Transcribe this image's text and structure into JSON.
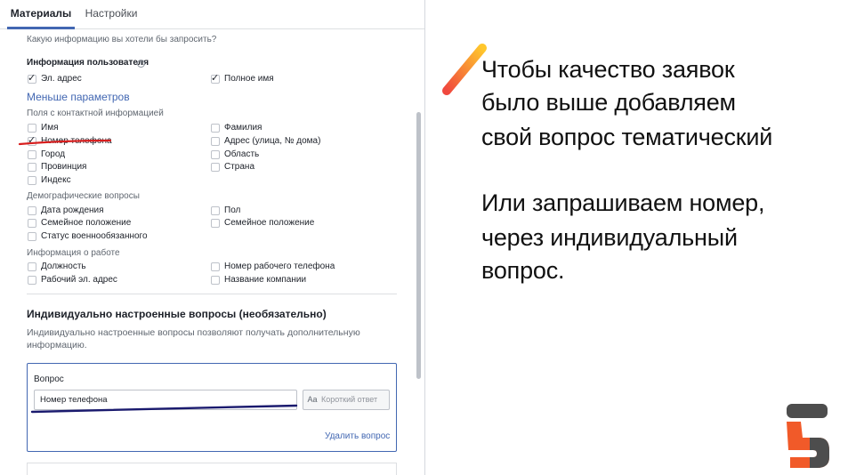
{
  "tabs": [
    {
      "label": "Материалы",
      "active": true
    },
    {
      "label": "Настройки",
      "active": false
    }
  ],
  "form": {
    "question_prompt": "Какую информацию вы хотели бы запросить?",
    "user_info_title": "Информация пользователя",
    "info_glyph": "i",
    "top_options": [
      {
        "label": "Эл. адрес",
        "checked": true
      },
      {
        "label": "Полное имя",
        "checked": true
      }
    ],
    "fewer_params": "Меньше параметров",
    "contact_title": "Поля с контактной информацией",
    "contact_fields": [
      {
        "label": "Имя",
        "checked": false
      },
      {
        "label": "Фамилия",
        "checked": false
      },
      {
        "label": "Номер телефона",
        "checked": true
      },
      {
        "label": "Адрес (улица, № дома)",
        "checked": false
      },
      {
        "label": "Город",
        "checked": false
      },
      {
        "label": "Область",
        "checked": false
      },
      {
        "label": "Провинция",
        "checked": false
      },
      {
        "label": "Страна",
        "checked": false
      },
      {
        "label": "Индекс",
        "checked": false
      }
    ],
    "demo_title": "Демографические вопросы",
    "demo_fields": [
      {
        "label": "Дата рождения",
        "checked": false
      },
      {
        "label": "Пол",
        "checked": false
      },
      {
        "label": "Семейное положение",
        "checked": false
      },
      {
        "label": "Семейное положение",
        "checked": false
      },
      {
        "label": "Статус военнообязанного",
        "checked": false
      }
    ],
    "work_title": "Информация о работе",
    "work_fields": [
      {
        "label": "Должность",
        "checked": false
      },
      {
        "label": "Номер рабочего телефона",
        "checked": false
      },
      {
        "label": "Рабочий эл. адрес",
        "checked": false
      },
      {
        "label": "Название компании",
        "checked": false
      }
    ],
    "custom_title": "Индивидуально настроенные вопросы (необязательно)",
    "custom_desc": "Индивидуально настроенные вопросы позволяют получать дополнительную информацию.",
    "question_label": "Вопрос",
    "question_value": "Номер телефона",
    "answer_type_icon": "Aa",
    "answer_type": "Короткий ответ",
    "delete_question": "Удалить вопрос"
  },
  "annotation": {
    "line1": "Чтобы качество заявок",
    "line2": "было выше добавляем",
    "line3": "свой вопрос тематический",
    "line4": "Или запрашиваем номер,",
    "line5": "через индивидуальный",
    "line6": "вопрос."
  },
  "colors": {
    "accent": "#4267b2",
    "red_underline": "#d81e1e",
    "navy_underline": "#1a1a6e",
    "logo_orange": "#f15a29",
    "logo_dark": "#4d4d4d",
    "slash_yellow": "#ffc72c",
    "slash_red": "#f0483e"
  }
}
